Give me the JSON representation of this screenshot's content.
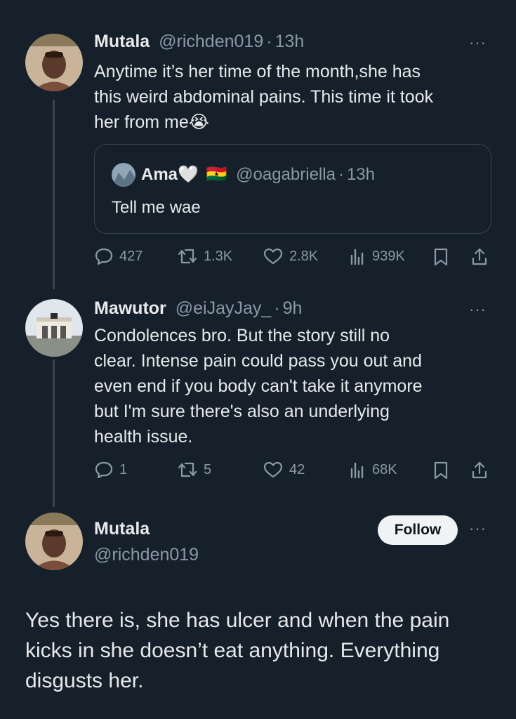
{
  "tweets": [
    {
      "name": "Mutala",
      "handle": "@richden019",
      "dot": "·",
      "time": "13h",
      "text_lines": [
        "Anytime it’s her time of the month,she has",
        "this weird abdominal pains. This time it took",
        "her from me😭"
      ],
      "quote": {
        "name": "Ama🤍",
        "flag": "🇬🇭",
        "handle": "@oagabriella",
        "dot": "·",
        "time": "13h",
        "text": "Tell me wae"
      },
      "stats": {
        "replies": "427",
        "reposts": "1.3K",
        "likes": "2.8K",
        "views": "939K"
      }
    },
    {
      "name": "Mawutor",
      "handle": "@eiJayJay_",
      "dot": "·",
      "time": "9h",
      "text_lines": [
        "Condolences bro. But the story still no",
        "clear. Intense pain could pass you out and",
        "even end if you body can't take it anymore",
        "but I'm sure there's also an underlying",
        "health issue."
      ],
      "stats": {
        "replies": "1",
        "reposts": "5",
        "likes": "42",
        "views": "68K"
      }
    }
  ],
  "main": {
    "name": "Mutala",
    "handle": "@richden019",
    "follow_label": "Follow",
    "text_lines": [
      "Yes there is, she has ulcer and when the pain",
      "kicks in she doesn’t eat anything. Everything",
      "disgusts her."
    ]
  },
  "more_label": "···",
  "icons": [
    "reply-icon",
    "repost-icon",
    "like-icon",
    "views-icon",
    "bookmark-icon",
    "share-icon",
    "more-icon"
  ]
}
